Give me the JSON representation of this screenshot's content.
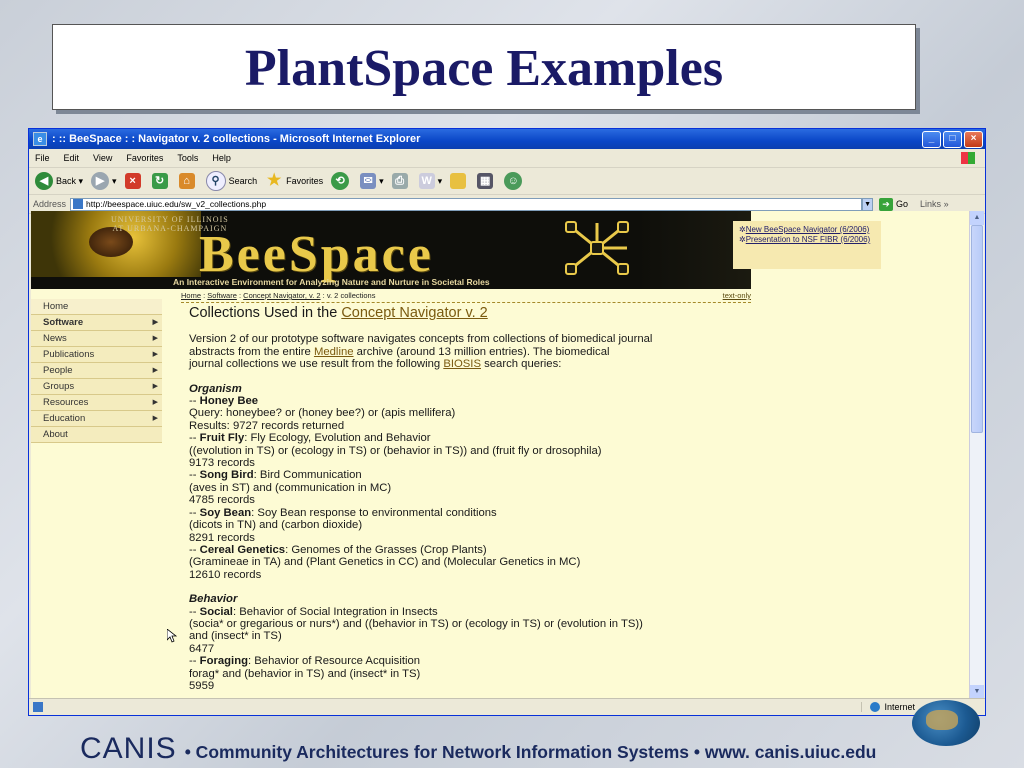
{
  "slide": {
    "title": "PlantSpace Examples",
    "footer_logo": "CANIS",
    "footer_text": "• Community Architectures for Network Information Systems •  www. canis.uiuc.edu"
  },
  "window": {
    "title": ": :: BeeSpace : : Navigator v. 2 collections - Microsoft Internet Explorer",
    "menu": [
      "File",
      "Edit",
      "View",
      "Favorites",
      "Tools",
      "Help"
    ],
    "toolbar": {
      "back": "Back",
      "search": "Search",
      "favorites": "Favorites"
    },
    "address_label": "Address",
    "url": "http://beespace.uiuc.edu/sw_v2_collections.php",
    "go": "Go",
    "links": "Links",
    "status_zone": "Internet"
  },
  "banner": {
    "university_line1": "UNIVERSITY OF ILLINOIS",
    "university_line2": "AT URBANA-CHAMPAIGN",
    "logo": "BeeSpace",
    "tagline": "An Interactive Environment for Analyzing Nature and Nurture in Societal Roles",
    "news1": "New BeeSpace Navigator (6/2006)",
    "news2": "Presentation to NSF FIBR (6/2006)"
  },
  "breadcrumb": {
    "home": "Home",
    "software": "Software",
    "concept": "Concept Navigator, v. 2",
    "current": ": v. 2 collections",
    "text_only": "text-only"
  },
  "nav": [
    "Home",
    "Software",
    "News",
    "Publications",
    "People",
    "Groups",
    "Resources",
    "Education",
    "About"
  ],
  "content": {
    "heading_prefix": "Collections Used in the ",
    "heading_link": "Concept Navigator v. 2",
    "intro_1": "Version 2 of our prototype software navigates concepts from collections of biomedical journal",
    "intro_2a": "abstracts from the entire ",
    "intro_medline": "Medline",
    "intro_2b": " archive (around 13 million entries). The biomedical",
    "intro_3a": "journal collections we use result from the following ",
    "intro_biosis": "BIOSIS",
    "intro_3b": " search queries:",
    "organism": "Organism",
    "honeybee_label": "Honey Bee",
    "honeybee_query": "Query:    honeybee? or (honey bee?) or (apis mellifera)",
    "honeybee_results": "Results:  9727 records returned",
    "fruitfly_label": "Fruit Fly",
    "fruitfly_desc": ":  Fly Ecology, Evolution and Behavior",
    "fruitfly_query": "((evolution in TS) or (ecology in TS) or (behavior in TS)) and (fruit fly or drosophila)",
    "fruitfly_records": "9173 records",
    "songbird_label": "Song Bird",
    "songbird_desc": ":  Bird Communication",
    "songbird_query": "(aves in ST) and (communication in MC)",
    "songbird_records": "4785 records",
    "soybean_label": "Soy Bean",
    "soybean_desc": ": Soy Bean response to environmental conditions",
    "soybean_query": "(dicots in TN) and (carbon dioxide)",
    "soybean_records": "8291 records",
    "cereal_label": "Cereal Genetics",
    "cereal_desc": ": Genomes of the Grasses (Crop Plants)",
    "cereal_query": "(Gramineae in TA) and (Plant Genetics in CC) and (Molecular Genetics in MC)",
    "cereal_records": "12610 records",
    "behavior": "Behavior",
    "social_label": "Social",
    "social_desc": ": Behavior of Social Integration in Insects",
    "social_query1": "(socia* or gregarious or nurs*) and ((behavior in TS) or (ecology in TS) or (evolution in TS))",
    "social_query2": "and (insect* in TS)",
    "social_records": "6477",
    "foraging_label": "Foraging",
    "foraging_desc": ": Behavior of Resource Acquisition",
    "foraging_query": "forag* and (behavior in TS) and (insect* in TS)",
    "foraging_records": "5959",
    "dash": "-- "
  }
}
